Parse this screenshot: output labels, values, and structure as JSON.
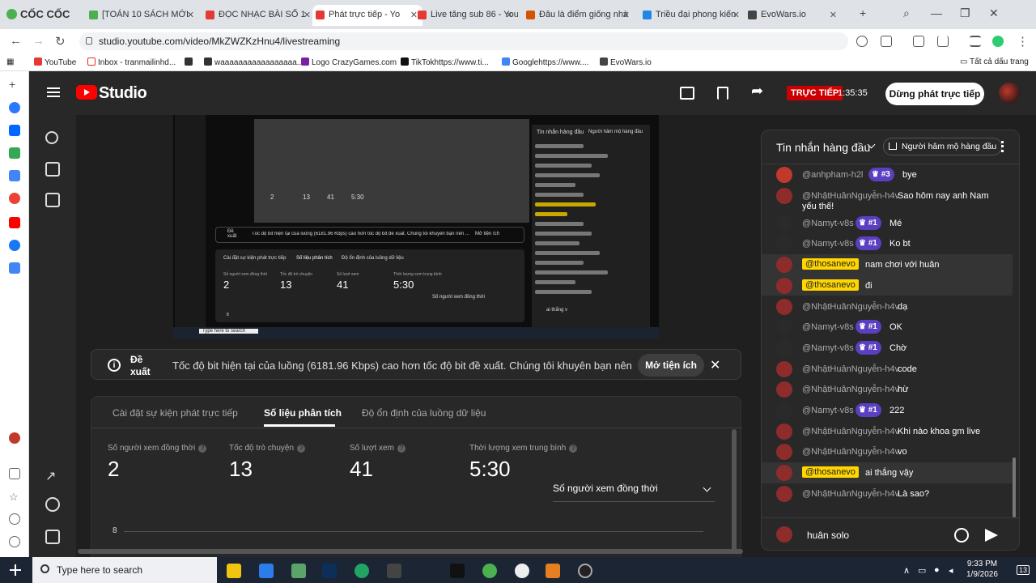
{
  "browser": {
    "brand": "CỐC CỐC",
    "tabs": [
      {
        "label": "[TOÁN 10 SÁCH MỚI",
        "color": "#4caf50"
      },
      {
        "label": "ĐỌC NHẠC BÀI SỐ 1",
        "color": "#e53935"
      },
      {
        "label": "Phát trực tiếp - Yo",
        "color": "#e53935",
        "active": true
      },
      {
        "label": "Live tăng sub 86 - You",
        "color": "#e53935"
      },
      {
        "label": "Đâu là điểm giống nhà",
        "color": "#d35400"
      },
      {
        "label": "Triều đại phong kiến",
        "color": "#1e88e5"
      },
      {
        "label": "EvoWars.io",
        "color": "#444444"
      }
    ],
    "url": "studio.youtube.com/video/MkZWZKzHnu4/livestreaming",
    "bookmarks": [
      {
        "label": "YouTube",
        "color": "#e53935"
      },
      {
        "label": "Inbox - tranmailinhd...",
        "color": "#fff",
        "border": "#d93025"
      },
      {
        "label": "",
        "color": "#333"
      },
      {
        "label": "waaaaaaaaaaaaaaaaa...",
        "color": "#333"
      },
      {
        "label": "Logo CrazyGames.com",
        "color": "#7b1fa2"
      },
      {
        "label": "TikTokhttps://www.ti...",
        "color": "#111"
      },
      {
        "label": "Googlehttps://www....",
        "color": "#4285f4"
      },
      {
        "label": "EvoWars.io",
        "color": "#444"
      }
    ],
    "all_bookmarks": "Tất cả dấu trang"
  },
  "studio": {
    "logo": "Studio",
    "live_badge": "TRỰC TIẾP",
    "timer": "1:35:35",
    "end_button": "Dừng phát trực tiếp"
  },
  "preview": {
    "chat_title": "Tin nhắn hàng đầu",
    "chat_top": "Người hâm mộ hàng đầu",
    "banner_title": "Đề xuất",
    "banner_text": "Tốc độ bit hiện tại của luồng (6181.96 Kbps) cao hơn tốc độ bit đề xuất. Chúng tôi khuyên bạn nên ...",
    "banner_btn": "Mở tiện ích",
    "tab1": "Cài đặt sự kiện phát trực tiếp",
    "tab2": "Số liệu phân tích",
    "tab3": "Độ ổn định của luồng dữ liệu",
    "m1": "Số người xem đồng thời",
    "v1": "2",
    "m2": "Tốc độ trò chuyện",
    "v2": "13",
    "m3": "Số lượt xem",
    "v3": "41",
    "m4": "Thời lượng xem trung bình",
    "v4": "5:30",
    "dropdown": "Số người xem đồng thời",
    "yaxis": "8",
    "chat_input": "ai thắng v",
    "search": "Type here to search"
  },
  "banner": {
    "title": "Đề xuất",
    "text": "Tốc độ bit hiện tại của luồng (6181.96 Kbps) cao hơn tốc độ bit đề xuất. Chúng tôi khuyên bạn nên ...",
    "button": "Mở tiện ích"
  },
  "analytics": {
    "tabs": [
      "Cài đặt sự kiện phát trực tiếp",
      "Số liệu phân tích",
      "Độ ổn định của luồng dữ liệu"
    ],
    "metrics": [
      {
        "label": "Số người xem đồng thời",
        "value": "2"
      },
      {
        "label": "Tốc độ trò chuyện",
        "value": "13"
      },
      {
        "label": "Số lượt xem",
        "value": "41"
      },
      {
        "label": "Thời lượng xem trung bình",
        "value": "5:30"
      }
    ],
    "dropdown": "Số người xem đồng thời",
    "y_tick": "8"
  },
  "chat": {
    "title": "Tin nhắn hàng đầu",
    "top_fans": "Người hâm mộ hàng đầu",
    "messages": [
      {
        "author": "@anhpham-h2l",
        "badge": "#3",
        "text": "bye",
        "own": false,
        "av": "#c0392b"
      },
      {
        "author": "@NhậtHuânNguyễn-h4v",
        "badge": "",
        "text": "Sao hôm nay anh Nam",
        "text2": "yếu thế!",
        "own": false,
        "av": "#8e2b2b"
      },
      {
        "author": "@Namyt-v8s",
        "badge": "#1",
        "text": "Mé",
        "own": false,
        "av": "#2a2a2a"
      },
      {
        "author": "@Namyt-v8s",
        "badge": "#1",
        "text": "Ko bt",
        "own": false,
        "av": "#2a2a2a"
      },
      {
        "author": "@thosanevo",
        "badge": "",
        "text": "nam chơi với huân",
        "own": true,
        "av": "#8e2b2b"
      },
      {
        "author": "@thosanevo",
        "badge": "",
        "text": "đi",
        "own": true,
        "av": "#8e2b2b"
      },
      {
        "author": "@NhậtHuânNguyễn-h4v",
        "badge": "",
        "text": "dạ",
        "own": false,
        "av": "#8e2b2b"
      },
      {
        "author": "@Namyt-v8s",
        "badge": "#1",
        "text": "OK",
        "own": false,
        "av": "#2a2a2a"
      },
      {
        "author": "@Namyt-v8s",
        "badge": "#1",
        "text": "Chờ",
        "own": false,
        "av": "#2a2a2a"
      },
      {
        "author": "@NhậtHuânNguyễn-h4v",
        "badge": "",
        "text": "code",
        "own": false,
        "av": "#8e2b2b"
      },
      {
        "author": "@NhậtHuânNguyễn-h4v",
        "badge": "",
        "text": "hừ",
        "own": false,
        "av": "#8e2b2b"
      },
      {
        "author": "@Namyt-v8s",
        "badge": "#1",
        "text": "222",
        "own": false,
        "av": "#2a2a2a"
      },
      {
        "author": "@NhậtHuânNguyễn-h4v",
        "badge": "",
        "text": "Khi nào khoa gm live",
        "own": false,
        "av": "#8e2b2b"
      },
      {
        "author": "@NhậtHuânNguyễn-h4v",
        "badge": "",
        "text": "vo",
        "own": false,
        "av": "#8e2b2b"
      },
      {
        "author": "@thosanevo",
        "badge": "",
        "text": "ai thắng vậy",
        "own": true,
        "av": "#8e2b2b"
      },
      {
        "author": "@NhậtHuânNguyễn-h4v",
        "badge": "",
        "text": "Là sao?",
        "own": false,
        "av": "#8e2b2b"
      }
    ],
    "input_value": "huân solo"
  },
  "taskbar": {
    "search": "Type here to search",
    "time": "9:33 PM",
    "date": "1/9/2026",
    "notif": "13"
  }
}
